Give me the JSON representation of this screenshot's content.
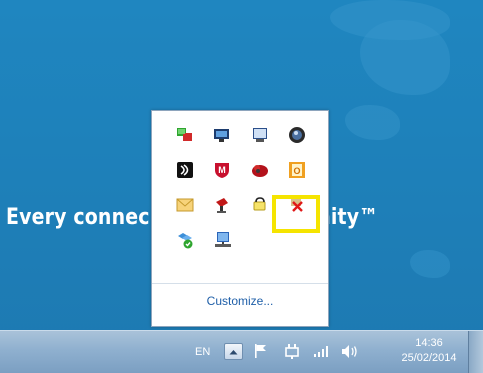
{
  "wallpaper": {
    "text_left": "Every connec",
    "text_right": "ortunity™"
  },
  "tray_popup": {
    "icons": [
      [
        "network-monitor-icon",
        "display-settings-icon",
        "screen-icon",
        "media-icon"
      ],
      [
        "wireless-icon",
        "mcafee-icon",
        "creative-cloud-icon",
        "office-icon"
      ],
      [
        "mail-icon",
        "stamp-icon",
        "pen-icon",
        "network-error-icon"
      ],
      [
        "sync-check-icon",
        "network-computer-icon"
      ]
    ],
    "highlighted_icon": "network-error-icon",
    "customize_label": "Customize..."
  },
  "taskbar": {
    "language": "EN",
    "time": "14:36",
    "date": "25/02/2014"
  },
  "colors": {
    "desktop": "#1e7fb8",
    "highlight": "#f5e400",
    "link": "#1f5fa8"
  }
}
